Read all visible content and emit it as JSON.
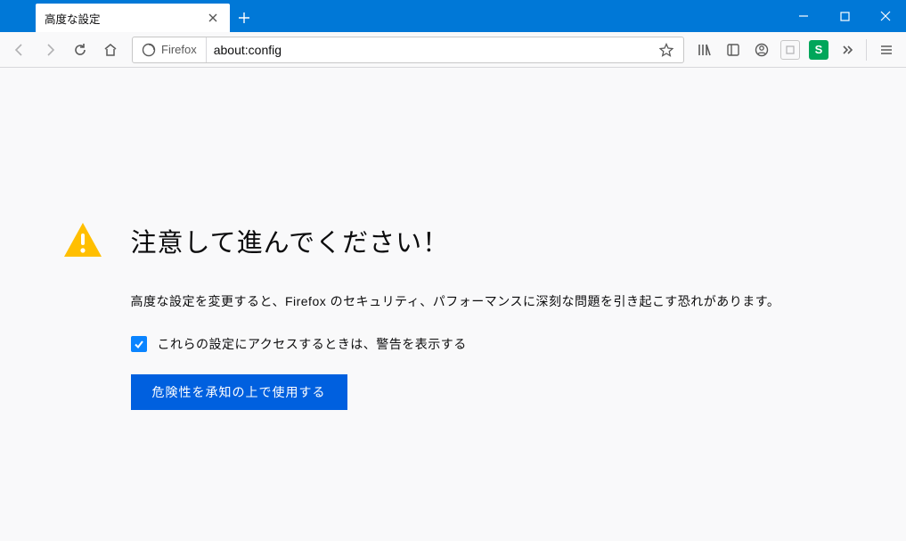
{
  "window": {
    "tab_title": "高度な設定",
    "identity_label": "Firefox",
    "url": "about:config"
  },
  "page": {
    "title": "注意して進んでください！",
    "description": "高度な設定を変更すると、Firefox のセキュリティ、パフォーマンスに深刻な問題を引き起こす恐れがあります。",
    "checkbox_label": "これらの設定にアクセスするときは、警告を表示する",
    "accept_button": "危険性を承知の上で使用する"
  },
  "toolbar_ext": {
    "addon_letter": "S"
  }
}
